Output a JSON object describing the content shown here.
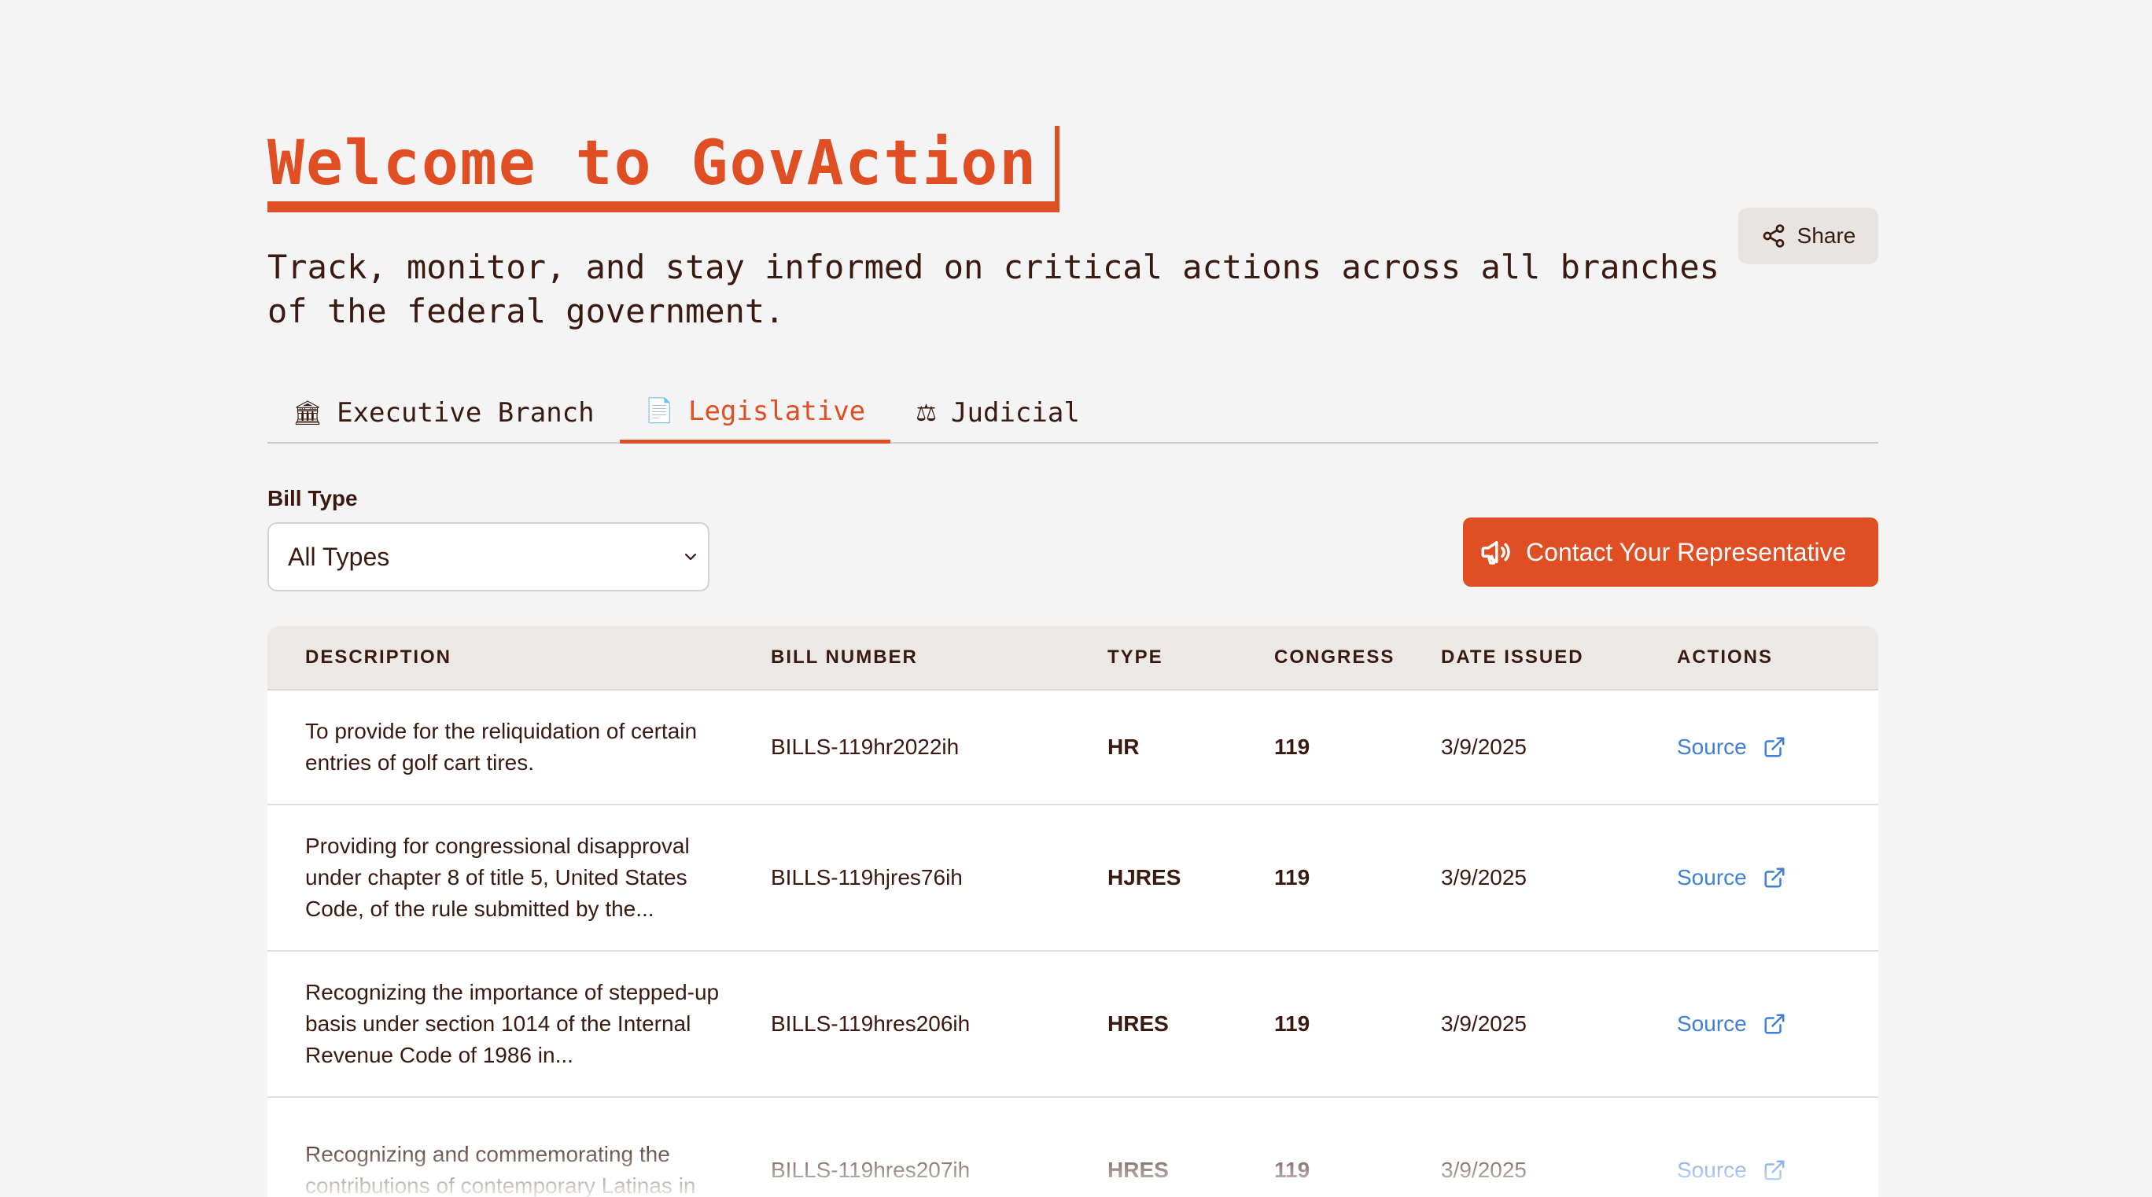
{
  "header": {
    "title": "Welcome to GovAction",
    "subtitle": "Track, monitor, and stay informed on critical actions across all branches of the federal government.",
    "share_label": "Share"
  },
  "tabs": [
    {
      "label": "Executive Branch",
      "icon": "🏛",
      "icon_name": "building-icon",
      "active": false
    },
    {
      "label": "Legislative",
      "icon": "📄",
      "icon_name": "document-icon",
      "active": true
    },
    {
      "label": "Judicial",
      "icon": "⚖",
      "icon_name": "scales-icon",
      "active": false
    }
  ],
  "filter": {
    "label": "Bill Type",
    "selected": "All Types"
  },
  "contact_label": "Contact Your Representative",
  "table": {
    "headers": [
      "DESCRIPTION",
      "BILL NUMBER",
      "TYPE",
      "CONGRESS",
      "DATE ISSUED",
      "ACTIONS"
    ],
    "rows": [
      {
        "description": "To provide for the reliquidation of certain entries of golf cart tires.",
        "bill_number": "BILLS-119hr2022ih",
        "type": "HR",
        "congress": "119",
        "date": "3/9/2025",
        "action": "Source"
      },
      {
        "description": "Providing for congressional disapproval under chapter 8 of title 5, United States Code, of the rule submitted by the...",
        "bill_number": "BILLS-119hjres76ih",
        "type": "HJRES",
        "congress": "119",
        "date": "3/9/2025",
        "action": "Source"
      },
      {
        "description": "Recognizing the importance of stepped-up basis under section 1014 of the Internal Revenue Code of 1986 in...",
        "bill_number": "BILLS-119hres206ih",
        "type": "HRES",
        "congress": "119",
        "date": "3/9/2025",
        "action": "Source"
      },
      {
        "description": "Recognizing and commemorating the contributions of contemporary Latinas in",
        "bill_number": "BILLS-119hres207ih",
        "type": "HRES",
        "congress": "119",
        "date": "3/9/2025",
        "action": "Source"
      }
    ]
  },
  "colors": {
    "accent": "#e04e24",
    "link": "#3f7fd8",
    "text": "#3a1a10",
    "background": "#f4f4f4"
  }
}
